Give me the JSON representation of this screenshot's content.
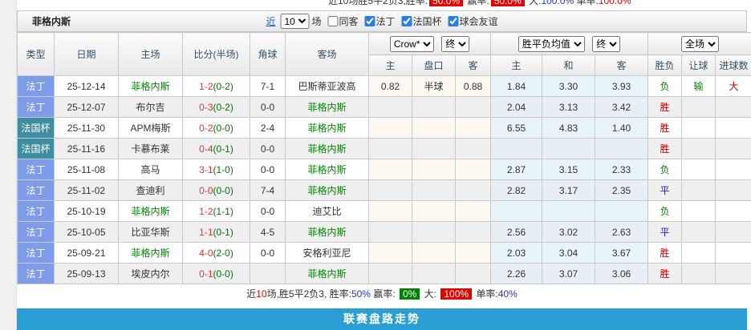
{
  "colors": {
    "accent_bar": "#2b9fd4",
    "ligue_badge": "#7e9ce8",
    "cup_badge": "#3f8da1",
    "win_red": "#cc0000",
    "draw_blue": "#2222cc",
    "lose_green": "#008800",
    "odds_col_bg": "#e9f3fa",
    "score_red": "#e53333",
    "half_green": "#007700",
    "badge_red": "#e60000",
    "badge_green": "#008000"
  },
  "top_strip": {
    "segments": [
      {
        "text": "近10场胜5平2负3,胜率:"
      },
      {
        "text": "50.0%",
        "style": "red-badge"
      },
      {
        "text": " 赢率:"
      },
      {
        "text": "50.0%",
        "style": "red-badge"
      },
      {
        "text": " 大:"
      },
      {
        "text": "100.0%",
        "style": "blue"
      },
      {
        "text": " 单率:"
      },
      {
        "text": "100.0%",
        "style": "red"
      }
    ]
  },
  "panel": {
    "title": "菲格内斯",
    "controls": {
      "recent_label": "近",
      "count": "10",
      "suffix": "场",
      "checkboxes": [
        {
          "label": "同客",
          "checked": false
        },
        {
          "label": "法丁",
          "checked": true
        },
        {
          "label": "法国杯",
          "checked": true
        },
        {
          "label": "球会友谊",
          "checked": true
        }
      ]
    }
  },
  "table": {
    "left_headers": [
      "类型",
      "日期",
      "主场",
      "比分(半场)",
      "角球",
      "客场"
    ],
    "selects": {
      "bookmaker": "Crow*",
      "bookmaker_stage": "终",
      "avg": "胜平负均值",
      "avg_stage": "终",
      "scope": "全场"
    },
    "subheaders": [
      "主",
      "盘口",
      "客",
      "主",
      "和",
      "客",
      "胜负",
      "让球",
      "进球数"
    ],
    "rows": [
      {
        "type": "法丁",
        "date": "25-12-14",
        "home": "菲格内斯",
        "score": "1-2(0-2)",
        "corner": "7-1",
        "away": "巴斯蒂亚波高",
        "asia_home": "0.82",
        "handicap": "半球",
        "asia_away": "0.88",
        "euro_home": "1.84",
        "euro_draw": "3.30",
        "euro_away": "3.93",
        "outcome": "负",
        "handicap_result": "输",
        "goals": "大"
      },
      {
        "type": "法丁",
        "date": "25-12-07",
        "home": "布尔吉",
        "score": "0-3(0-2)",
        "corner": "0-0",
        "away": "菲格内斯",
        "asia_home": "",
        "handicap": "",
        "asia_away": "",
        "euro_home": "2.04",
        "euro_draw": "3.13",
        "euro_away": "3.42",
        "outcome": "胜",
        "handicap_result": "",
        "goals": ""
      },
      {
        "type": "法国杯",
        "date": "25-11-30",
        "home": "APM梅斯",
        "score": "0-2(0-0)",
        "corner": "2-4",
        "away": "菲格内斯",
        "asia_home": "",
        "handicap": "",
        "asia_away": "",
        "euro_home": "6.55",
        "euro_draw": "4.83",
        "euro_away": "1.40",
        "outcome": "胜",
        "handicap_result": "",
        "goals": ""
      },
      {
        "type": "法国杯",
        "date": "25-11-16",
        "home": "卡慕布莱",
        "score": "0-4(0-1)",
        "corner": "0-0",
        "away": "菲格内斯",
        "asia_home": "",
        "handicap": "",
        "asia_away": "",
        "euro_home": "",
        "euro_draw": "",
        "euro_away": "",
        "outcome": "胜",
        "handicap_result": "",
        "goals": ""
      },
      {
        "type": "法丁",
        "date": "25-11-08",
        "home": "高马",
        "score": "3-1(1-0)",
        "corner": "0-0",
        "away": "菲格内斯",
        "asia_home": "",
        "handicap": "",
        "asia_away": "",
        "euro_home": "2.87",
        "euro_draw": "3.15",
        "euro_away": "2.33",
        "outcome": "负",
        "handicap_result": "",
        "goals": ""
      },
      {
        "type": "法丁",
        "date": "25-11-02",
        "home": "查迪利",
        "score": "0-0(0-0)",
        "corner": "7-4",
        "away": "菲格内斯",
        "asia_home": "",
        "handicap": "",
        "asia_away": "",
        "euro_home": "2.82",
        "euro_draw": "3.17",
        "euro_away": "2.35",
        "outcome": "平",
        "handicap_result": "",
        "goals": ""
      },
      {
        "type": "法丁",
        "date": "25-10-19",
        "home": "菲格内斯",
        "score": "1-2(1-1)",
        "corner": "0-0",
        "away": "迪艾比",
        "asia_home": "",
        "handicap": "",
        "asia_away": "",
        "euro_home": "",
        "euro_draw": "",
        "euro_away": "",
        "outcome": "负",
        "handicap_result": "",
        "goals": ""
      },
      {
        "type": "法丁",
        "date": "25-10-05",
        "home": "比亚华斯",
        "score": "1-1(0-1)",
        "corner": "4-5",
        "away": "菲格内斯",
        "asia_home": "",
        "handicap": "",
        "asia_away": "",
        "euro_home": "2.56",
        "euro_draw": "3.02",
        "euro_away": "2.63",
        "outcome": "平",
        "handicap_result": "",
        "goals": ""
      },
      {
        "type": "法丁",
        "date": "25-09-21",
        "home": "菲格内斯",
        "score": "4-0(2-0)",
        "corner": "0-0",
        "away": "安格利亚尼",
        "asia_home": "",
        "handicap": "",
        "asia_away": "",
        "euro_home": "2.03",
        "euro_draw": "3.04",
        "euro_away": "3.67",
        "outcome": "胜",
        "handicap_result": "",
        "goals": ""
      },
      {
        "type": "法丁",
        "date": "25-09-13",
        "home": "埃皮内尔",
        "score": "0-1(0-0)",
        "corner": "",
        "away": "菲格内斯",
        "asia_home": "",
        "handicap": "",
        "asia_away": "",
        "euro_home": "2.26",
        "euro_draw": "3.07",
        "euro_away": "3.06",
        "outcome": "胜",
        "handicap_result": "",
        "goals": ""
      }
    ]
  },
  "summary": {
    "segments": [
      {
        "text": "近"
      },
      {
        "text": "10",
        "style": "red-text"
      },
      {
        "text": "场,胜5平2负3, 胜率:"
      },
      {
        "text": "50%",
        "style": "blue"
      },
      {
        "text": " 赢率: "
      },
      {
        "text": "0%",
        "style": "green-badge"
      },
      {
        "text": " 大: "
      },
      {
        "text": "100%",
        "style": "red-badge"
      },
      {
        "text": " 单率:"
      },
      {
        "text": "40%",
        "style": "blue"
      }
    ]
  },
  "footer_bar": {
    "label": "联赛盘路走势"
  }
}
